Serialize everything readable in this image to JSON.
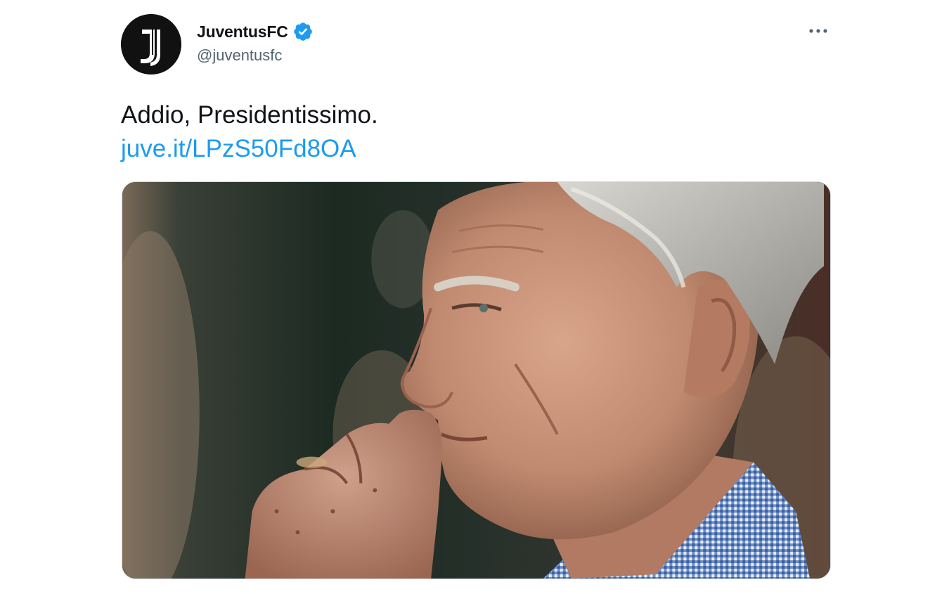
{
  "author": {
    "display_name": "JuventusFC",
    "handle": "@juventusfc",
    "avatar_icon": "juventus-j-logo",
    "verified_icon": "verified-badge-icon",
    "verified_color": "#1d9bf0"
  },
  "menu": {
    "more_icon": "more-options-icon"
  },
  "tweet": {
    "text": "Addio, Presidentissimo.",
    "link": "juve.it/LPzS50Fd8OA",
    "link_color": "#1d9bf0"
  },
  "media": {
    "type": "photo"
  },
  "colors": {
    "text_primary": "#0f1419",
    "text_secondary": "#536471",
    "background": "#ffffff"
  }
}
